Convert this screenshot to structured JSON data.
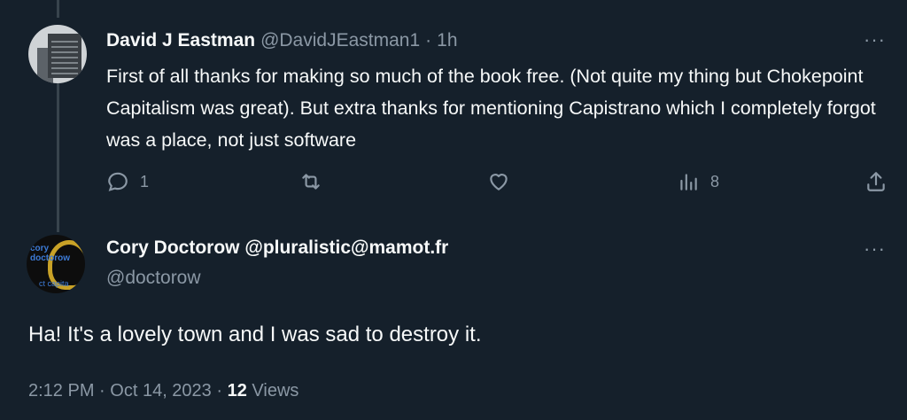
{
  "reply": {
    "author_name": "David J Eastman",
    "author_handle": "@DavidJEastman1",
    "separator": "·",
    "time": "1h",
    "text": "First of all thanks for making so much of the book free. (Not quite my thing but Chokepoint Capitalism was great). But extra thanks for mentioning Capistrano which I completely forgot was a place, not just software",
    "more_label": "···",
    "actions": {
      "reply_count": "1",
      "repost_count": "",
      "like_count": "",
      "views_count": "8"
    }
  },
  "main": {
    "author_name": "Cory Doctorow @pluralistic@mamot.fr",
    "author_handle": "@doctorow",
    "more_label": "···",
    "avatar_text_top": "cory doctorow",
    "avatar_text_bottom": "ct capita",
    "text": "Ha! It's a lovely town and I was sad to destroy it.",
    "time": "2:12 PM",
    "dot1": "·",
    "date": "Oct 14, 2023",
    "dot2": "·",
    "views_number": "12",
    "views_label": "Views"
  },
  "colors": {
    "background": "#15202b",
    "text": "#f7f9f9",
    "secondary": "#8b98a5",
    "thread_line": "#38444d"
  }
}
